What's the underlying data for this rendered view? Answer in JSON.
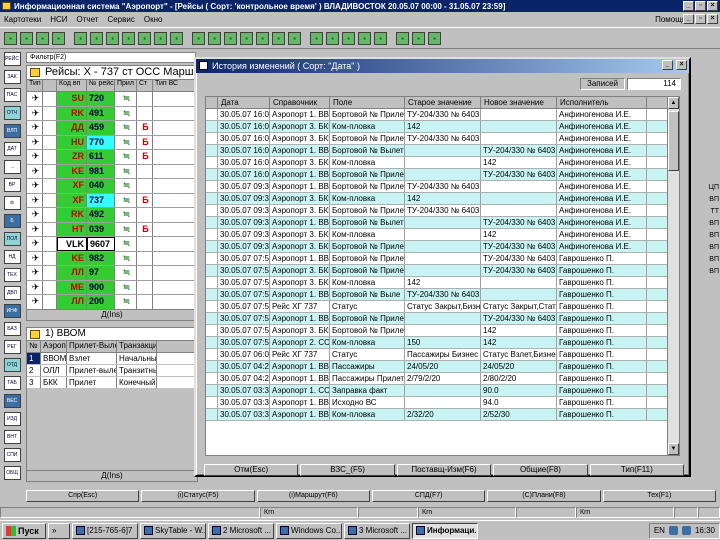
{
  "window": {
    "title": "Информационная система \"Аэропорт\" - [Рейсы ( Сорт: 'контрольное время' ) ВЛАДИВОСТОК 20.05.07 00:00 - 31.05.07 23:59]",
    "controls": [
      "_",
      "▫",
      "×"
    ]
  },
  "menu": {
    "items": [
      "Картотеки",
      "НСИ",
      "Отчет",
      "Сервис",
      "Окно"
    ],
    "help": "Помощь",
    "mdi_controls": [
      "_",
      "▫",
      "×"
    ]
  },
  "toolbar": {
    "icons": [
      "print-icon",
      "save-icon",
      "report-icon",
      "list-icon",
      "tree-icon",
      "tree-icon",
      "tree-icon",
      "grid-icon",
      "grid-icon",
      "map-icon",
      "map-icon",
      "plane-icon",
      "plane-icon",
      "plane-icon",
      "edit-icon",
      "edit-icon",
      "arrow-icon",
      "arrow-icon",
      "tool-icon",
      "tool-icon",
      "tool-icon",
      "tool-icon",
      "tool-icon",
      "note-icon",
      "flag-icon",
      "mail-icon"
    ]
  },
  "left_toolbar": {
    "labels": [
      "РЕЙС",
      "ЗАК",
      "ПАС",
      "ОТЧ",
      "ВЛП",
      "ДАТ",
      "→",
      "ВР",
      "⊘",
      "Б",
      "ПОЛ",
      "НД",
      "ТЕХ",
      "ДВЛ",
      "ИНФ",
      "БАЗ",
      "РЕГ",
      "ОТД",
      "ТАБ",
      "ВЕС",
      "ИЗД",
      "ВНТ",
      "СПИ",
      "ОБЩ"
    ]
  },
  "filter": {
    "label": "Фильтр(F2)"
  },
  "flights_window": {
    "title": "Рейсы: Х - 737 ст ОСС Маршрут",
    "columns": [
      "Тип",
      "",
      "Код вп",
      "№ рейс",
      "Прил",
      "Ст",
      "Тип ВС"
    ],
    "rows": [
      {
        "type": "✈",
        "code": "SU",
        "num": "720",
        "arr": "≒",
        "stat": "",
        "highlight": false
      },
      {
        "type": "✈",
        "code": "RK",
        "num": "491",
        "arr": "≒",
        "stat": "",
        "highlight": false
      },
      {
        "type": "✈",
        "code": "ДД",
        "num": "459",
        "arr": "≒",
        "stat": "Б",
        "highlight": false
      },
      {
        "type": "✈",
        "code": "HU",
        "num": "770",
        "arr": "≒",
        "stat": "Б",
        "highlight": true
      },
      {
        "type": "✈",
        "code": "ZR",
        "num": "611",
        "arr": "≒",
        "stat": "Б",
        "highlight": false
      },
      {
        "type": "✈",
        "code": "KE",
        "num": "981",
        "arr": "≒",
        "stat": "",
        "highlight": false
      },
      {
        "type": "✈",
        "code": "XF",
        "num": "040",
        "arr": "≒",
        "stat": "",
        "highlight": false
      },
      {
        "type": "✈",
        "code": "XF",
        "num": "737",
        "arr": "≒",
        "stat": "Б",
        "highlight": true
      },
      {
        "type": "✈",
        "code": "RK",
        "num": "492",
        "arr": "≒",
        "stat": "",
        "highlight": false
      },
      {
        "type": "✈",
        "code": "HT",
        "num": "039",
        "arr": "≒",
        "stat": "Б",
        "highlight": false
      },
      {
        "type": "✈",
        "code": "VLK",
        "num": "9607",
        "arr": "≒",
        "stat": "",
        "highlight": false,
        "selected": true
      },
      {
        "type": "✈",
        "code": "KE",
        "num": "982",
        "arr": "≒",
        "stat": "",
        "highlight": false
      },
      {
        "type": "✈",
        "code": "ЛЛ",
        "num": "97",
        "arr": "≒",
        "stat": "",
        "highlight": false
      },
      {
        "type": "✈",
        "code": "ME",
        "num": "900",
        "arr": "≒",
        "stat": "",
        "highlight": false
      },
      {
        "type": "✈",
        "code": "ЛЛ",
        "num": "200",
        "arr": "≒",
        "stat": "",
        "highlight": false
      }
    ],
    "footer": "Д(Ins)"
  },
  "route_window": {
    "title": "1) ВВОМ",
    "columns": [
      "№",
      "Аэропорт",
      "Прилет-Вылет",
      "Транзакция"
    ],
    "rows": [
      {
        "n": "1",
        "airport": "ВВОМ",
        "action": "Взлет",
        "kind": "Начальный",
        "selected": true
      },
      {
        "n": "2",
        "airport": "ОЛЛ",
        "action": "Прилет-вылет",
        "kind": "Транзитный",
        "selected": false
      },
      {
        "n": "3",
        "airport": "БКК",
        "action": "Прилет",
        "kind": "Конечный",
        "selected": false
      }
    ],
    "footer": "Д(Ins)"
  },
  "right_labels": [
    "ЦП",
    "ВП",
    "ТТ",
    "ВП",
    "ВП",
    "ВП",
    "ВП",
    "ВП"
  ],
  "main_buttons": [
    "Спр(Esc)",
    "(i)Статус(F5)",
    "(i)Маршрут(F6)",
    "СПД(F7)",
    "(C)Плани(F8)",
    "Тех(F1)"
  ],
  "status_bar": [
    "",
    "Кrn",
    "",
    "Кrn",
    "",
    "Кrn",
    "",
    ""
  ],
  "taskbar": {
    "start": "Пуск",
    "buttons": [
      {
        "label": "» ",
        "active": false
      },
      {
        "label": "[215-765-6]7",
        "active": false
      },
      {
        "label": "SkyTable - W...",
        "active": false
      },
      {
        "label": "2 Microsoft ...",
        "active": false
      },
      {
        "label": "Windows Co...",
        "active": false
      },
      {
        "label": "3 Microsoft ...",
        "active": false
      },
      {
        "label": "Информаци...",
        "active": true
      }
    ],
    "lang": "EN",
    "clock": "16:30"
  },
  "history_dialog": {
    "title": "История изменений ( Сорт: \"Дата\" )",
    "entries_label": "Записей",
    "entries_value": "114",
    "columns": [
      "",
      "Дата",
      "Справочник",
      "Поле",
      "Старое значение",
      "Новое значение",
      "Исполнитель"
    ],
    "rows": [
      {
        "date": "30.05.07 16:09",
        "ref": "Аэропорт 1. ВВС",
        "field": "Бортовой № Прилет",
        "old": "ТУ-204/330 № 6403",
        "new": "",
        "user": "Анфиногенова И.Е."
      },
      {
        "date": "30.05.07 16:09",
        "ref": "Аэропорт 3. БКК",
        "field": "Ком-пловка",
        "old": "142",
        "new": "",
        "user": "Анфиногенова И.Е."
      },
      {
        "date": "30.05.07 16:09",
        "ref": "Аэропорт 3. БКК",
        "field": "Бортовой № Прилет",
        "old": "ТУ-204/330 № 6403",
        "new": "",
        "user": "Анфиногенова И.Е."
      },
      {
        "date": "30.05.07 16:07",
        "ref": "Аэропорт 1. ВВС",
        "field": "Бортовой № Вылет",
        "old": "",
        "new": "ТУ-204/330 № 6403",
        "user": "Анфиногенова И.Е."
      },
      {
        "date": "30.05.07 16:07",
        "ref": "Аэропорт 3. БКК",
        "field": "Ком-пловка",
        "old": "",
        "new": "142",
        "user": "Анфиногенова И.Е."
      },
      {
        "date": "30.05.07 16:09",
        "ref": "Аэропорт 1. ВВС",
        "field": "Бортовой № Прилет",
        "old": "",
        "new": "ТУ-204/330 № 6403",
        "user": "Анфиногенова И.Е."
      },
      {
        "date": "30.05.07 09:31",
        "ref": "Аэропорт 1. ВВС",
        "field": "Бортовой № Прилет",
        "old": "ТУ-204/330 № 6403",
        "new": "",
        "user": "Анфиногенова И.Е."
      },
      {
        "date": "30.05.07 09:31",
        "ref": "Аэропорт 3. БКК",
        "field": "Ком-пловка",
        "old": "142",
        "new": "",
        "user": "Анфиногенова И.Е."
      },
      {
        "date": "30.05.07 09:31",
        "ref": "Аэропорт 3. БКК",
        "field": "Бортовой № Прилет",
        "old": "ТУ-204/330 № 6403",
        "new": "",
        "user": "Анфиногенова И.Е."
      },
      {
        "date": "30.05.07 09:31",
        "ref": "Аэропорт 1. ВВС",
        "field": "Бортовой № Вылет",
        "old": "",
        "new": "ТУ-204/330 № 6403",
        "user": "Анфиногенова И.Е."
      },
      {
        "date": "30.05.07 09:31",
        "ref": "Аэропорт 3. БКК",
        "field": "Ком-пловка",
        "old": "",
        "new": "142",
        "user": "Анфиногенова И.Е."
      },
      {
        "date": "30.05.07 09:31",
        "ref": "Аэропорт 3. БКК",
        "field": "Бортовой № Прилет",
        "old": "",
        "new": "ТУ-204/330 № 6403",
        "user": "Анфиногенова И.Е."
      },
      {
        "date": "30.05.07 07:53",
        "ref": "Аэропорт 1. ВВС",
        "field": "Бортовой № Прилет",
        "old": "",
        "new": "ТУ-204/330 № 6403",
        "user": "Гаврошенко П."
      },
      {
        "date": "30.05.07 07:53",
        "ref": "Аэропорт 3. БКК",
        "field": "Бортовой № Прилет",
        "old": "",
        "new": "ТУ-204/330 № 6403",
        "user": "Гаврошенко П."
      },
      {
        "date": "30.05.07 07:53",
        "ref": "Аэропорт 3. БКК",
        "field": "Ком-пловка",
        "old": "142",
        "new": "",
        "user": "Гаврошенко П."
      },
      {
        "date": "30.05.07 07:53",
        "ref": "Аэропорт 1. ВВС",
        "field": "Бортовой № Выле",
        "old": "ТУ-204/330 № 6403",
        "new": "",
        "user": "Гаврошенко П."
      },
      {
        "date": "30.05.07 07:53",
        "ref": "Рейс ХГ 737",
        "field": "Статус",
        "old": "Статус Закрыт,Бизнес",
        "new": "Статус Закрыт,Статус",
        "user": "Гаврошенко П."
      },
      {
        "date": "30.05.07 07:53",
        "ref": "Аэропорт 1. ВВС",
        "field": "Бортовой № Прилет",
        "old": "",
        "new": "ТУ-204/330 № 6403",
        "user": "Гаврошенко П."
      },
      {
        "date": "30.05.07 07:53",
        "ref": "Аэропорт 3. БКК",
        "field": "Бортовой № Прилет",
        "old": "",
        "new": "142",
        "user": "Гаврошенко П."
      },
      {
        "date": "30.05.07 07:53",
        "ref": "Аэропорт 2. ССС",
        "field": "Ком-пловка",
        "old": "150",
        "new": "142",
        "user": "Гаврошенко П."
      },
      {
        "date": "30.05.07 06:01",
        "ref": "Рейс ХГ 737",
        "field": "Статус",
        "old": "Пассажиры Бизнес",
        "new": "Статус Взлет,Бизнес",
        "user": "Гаврошенко П."
      },
      {
        "date": "30.05.07 04:24",
        "ref": "Аэропорт 1. ВВС",
        "field": "Пассажиры",
        "old": "24/05/20",
        "new": "24/05/20",
        "user": "Гаврошенко П."
      },
      {
        "date": "30.05.07 04:21",
        "ref": "Аэропорт 1. ВВС",
        "field": "Пассажиры Прилет",
        "old": "2/79/2/20",
        "new": "2/80/2/20",
        "user": "Гаврошенко П."
      },
      {
        "date": "30.05.07 03:33",
        "ref": "Аэропорт 1. ССС",
        "field": "Заправка факт",
        "old": "",
        "new": "90.0",
        "user": "Гаврошенко П."
      },
      {
        "date": "30.05.07 03:33",
        "ref": "Аэропорт 1. ВВС",
        "field": "Исходно ВС",
        "old": "",
        "new": "94.0",
        "user": "Гаврошенко П."
      },
      {
        "date": "30.05.07 03:33",
        "ref": "Аэропорт 1. ВВС",
        "field": "Ком-пловка",
        "old": "2/32/20",
        "new": "2/52/30",
        "user": "Гаврошенко П."
      }
    ],
    "buttons": [
      "Отм(Esc)",
      "ВЗС_(F5)",
      "Поставщ-Изм(F6)",
      "Общие(F8)",
      "Тип(F11)"
    ]
  }
}
